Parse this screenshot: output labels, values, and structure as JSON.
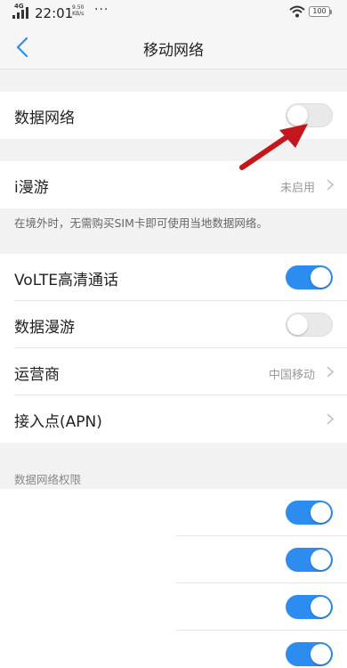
{
  "status_bar": {
    "network": "4G",
    "time": "22:01",
    "speed_value": "9.50",
    "speed_unit": "KB/s",
    "more": "···",
    "battery": "100"
  },
  "header": {
    "title": "移动网络"
  },
  "data_network": {
    "label": "数据网络",
    "enabled": false
  },
  "roaming_group": {
    "label": "i漫游",
    "value": "未启用",
    "note": "在境外时，无需购买SIM卡即可使用当地数据网络。"
  },
  "settings": {
    "volte": {
      "label": "VoLTE高清通话",
      "enabled": true
    },
    "data_roaming": {
      "label": "数据漫游",
      "enabled": false
    },
    "carrier": {
      "label": "运营商",
      "value": "中国移动"
    },
    "apn": {
      "label": "接入点(APN)"
    }
  },
  "permissions": {
    "section_title": "数据网络权限",
    "apps": [
      {
        "enabled": true
      },
      {
        "enabled": true
      },
      {
        "enabled": true
      },
      {
        "enabled": true
      }
    ]
  },
  "colors": {
    "toggle_on": "#2d8cf0",
    "annotation_arrow": "#c4161c"
  },
  "icons": [
    "signal-icon",
    "wifi-icon",
    "battery-icon",
    "back-chevron-icon",
    "chevron-right-icon",
    "annotation-arrow-icon"
  ]
}
